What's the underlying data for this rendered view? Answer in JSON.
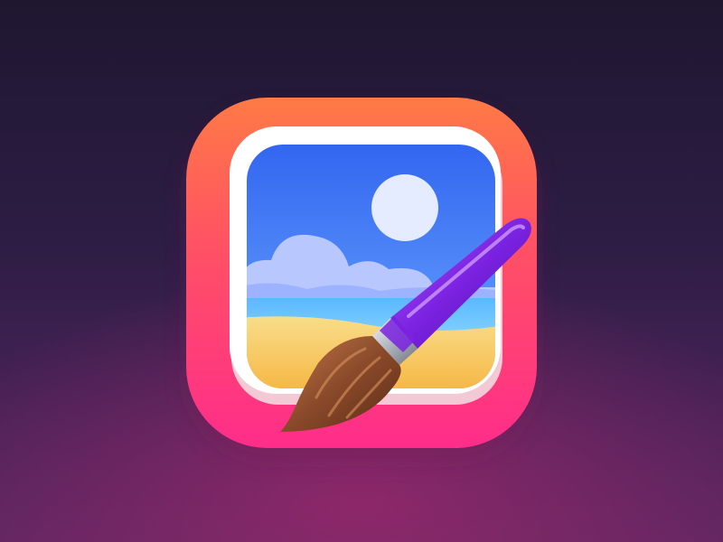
{
  "icon": {
    "name": "photo-paint-app-icon",
    "depicts": [
      "image-frame-icon",
      "sun-icon",
      "clouds-icon",
      "sea-icon",
      "beach-icon",
      "paintbrush-icon"
    ]
  },
  "colors": {
    "background_top": "#1f1730",
    "background_bottom": "#5a2760",
    "tile_top": "#ff7a45",
    "tile_bottom": "#ff2d8a",
    "sky_top": "#3b6cf2",
    "sky_bottom": "#6fa6ff",
    "sand": "#f7c35a",
    "brush_handle": "#8a2be2",
    "brush_bristles": "#8a4a2a"
  }
}
